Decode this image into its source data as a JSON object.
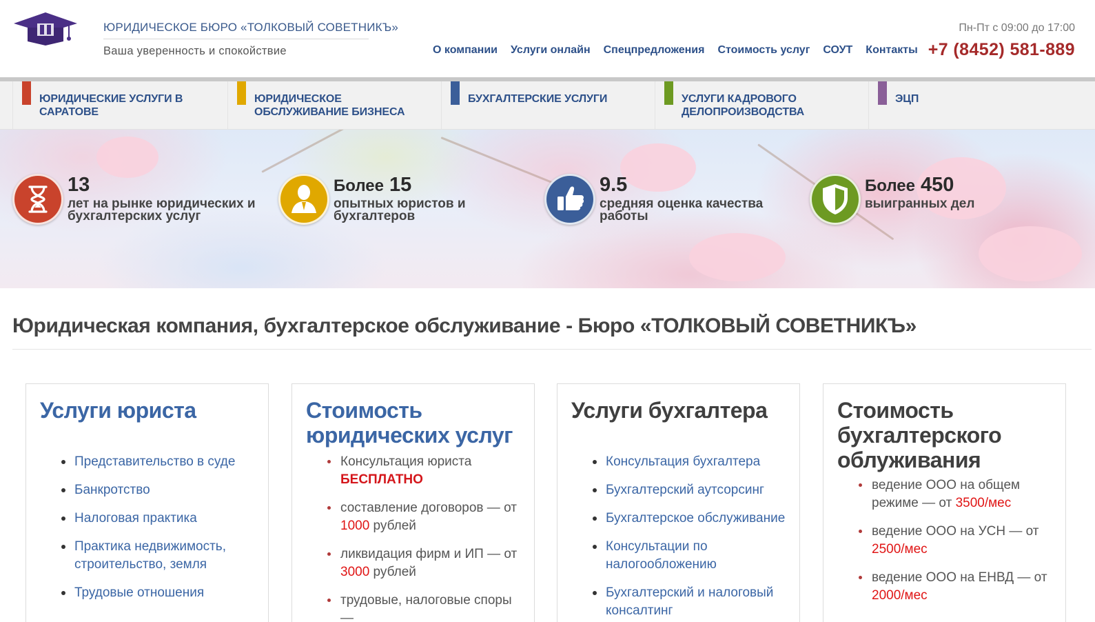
{
  "header": {
    "brand_name": "ЮРИДИЧЕСКОЕ БЮРО «ТОЛКОВЫЙ СОВЕТНИКЪ»",
    "tagline": "Ваша уверенность и спокойствие",
    "nav": [
      "О компании",
      "Услуги онлайн",
      "Спецпредложения",
      "Стоимость услуг",
      "СОУТ",
      "Контакты"
    ],
    "hours": "Пн-Пт с 09:00 до 17:00",
    "phone": "+7 (8452) 581-889"
  },
  "service_menu": [
    {
      "line1": "Юридические услуги в",
      "line2": "Саратове",
      "color": "#c9432c"
    },
    {
      "line1": "Юридическое",
      "line2": "обслуживание бизнеса",
      "color": "#e0a800"
    },
    {
      "line1": "Бухгалтерские услуги",
      "line2": "",
      "color": "#3b5e99"
    },
    {
      "line1": "Услуги кадрового",
      "line2": "делопроизводства",
      "color": "#6d9a22"
    },
    {
      "line1": "ЭЦП",
      "line2": "",
      "color": "#8a5f98"
    }
  ],
  "stats": [
    {
      "prefix": "",
      "number": "13",
      "line1": "лет на рынке юридических и",
      "line2": "бухгалтерских услуг",
      "icon": "hourglass-icon",
      "color": "#c9432c"
    },
    {
      "prefix": "Более",
      "number": "15",
      "line1": "опытных юристов и",
      "line2": "бухгалтеров",
      "icon": "person-icon",
      "color": "#e0a800"
    },
    {
      "prefix": "",
      "number": "9.5",
      "line1": "средняя оценка качества",
      "line2": "работы",
      "icon": "thumbs-up-icon",
      "color": "#3b5e99"
    },
    {
      "prefix": "Более",
      "number": "450",
      "line1": "выигранных дел",
      "line2": "",
      "icon": "shield-icon",
      "color": "#6d9a22"
    }
  ],
  "main": {
    "title": "Юридическая компания, бухгалтерское обслуживание - Бюро «ТОЛКОВЫЙ СОВЕТНИКЪ»"
  },
  "cards": {
    "lawyer": {
      "title": "Услуги юриста",
      "items": [
        "Представительство в суде",
        "Банкротство",
        "Налоговая практика",
        "Практика недвижимость, строительство, земля",
        "Трудовые отношения"
      ]
    },
    "legal_prices": {
      "title": "Стоимость юридических услуг",
      "items": [
        {
          "text": "Консультация юриста",
          "price": "БЕСПЛАТНО",
          "suffix": ""
        },
        {
          "text": "составление договоров — от",
          "price": "1000",
          "suffix": " рублей"
        },
        {
          "text": "ликвидация фирм и ИП — от",
          "price": "3000",
          "suffix": " рублей"
        },
        {
          "text": "трудовые, налоговые споры —",
          "price": "",
          "suffix": ""
        }
      ]
    },
    "accountant": {
      "title": "Услуги бухгалтера",
      "items": [
        "Консультация бухгалтера",
        "Бухгалтерский аутсорсинг",
        "Бухгалтерское обслуживание",
        "Консультации по налогообложению",
        "Бухгалтерский и налоговый консалтинг"
      ]
    },
    "accounting_prices": {
      "title": "Стоимость бухгалтерского облуживания",
      "items": [
        {
          "text": "ведение ООО на общем режиме — от",
          "price": "3500/мес"
        },
        {
          "text": "ведение ООО на УСН — от",
          "price": "2500/мес"
        },
        {
          "text": "ведение ООО на ЕНВД — от",
          "price": "2000/мес"
        }
      ]
    }
  },
  "colors": {
    "link_blue": "#3b66a5",
    "nav_blue": "#2d5089",
    "phone_red": "#a52a2a",
    "price_red": "#e01515"
  }
}
